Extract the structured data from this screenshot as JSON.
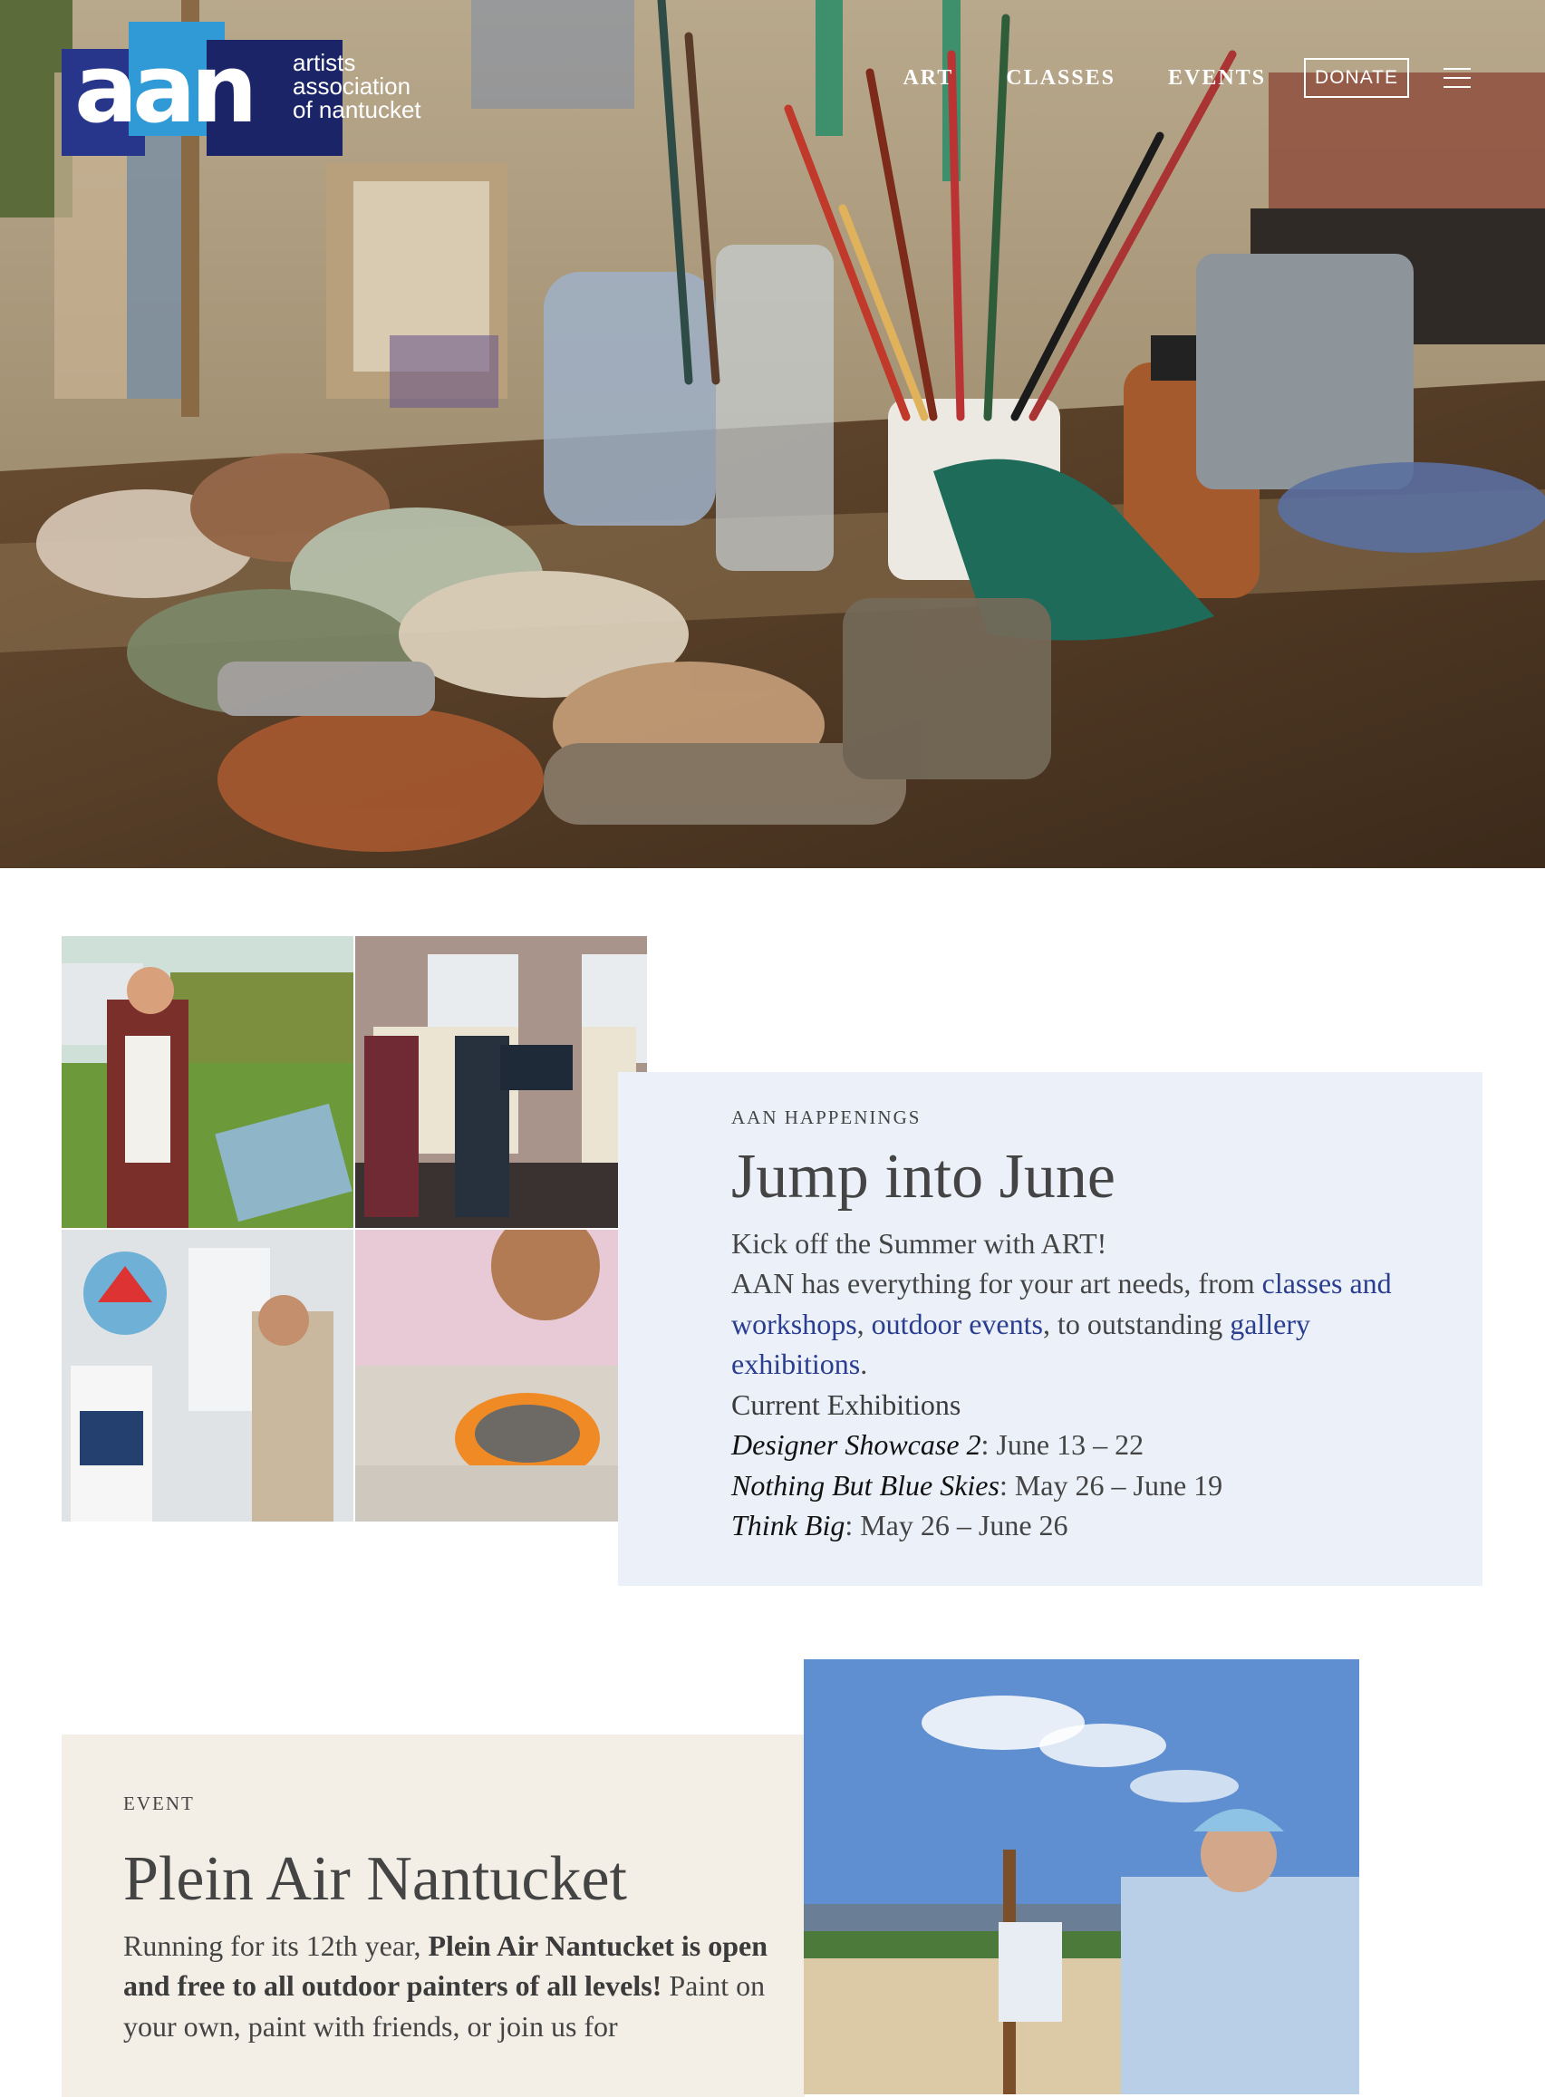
{
  "header": {
    "logo_mark": "aan",
    "logo_lines": [
      "artists",
      "association",
      "of nantucket"
    ],
    "nav": [
      {
        "label": "ART"
      },
      {
        "label": "CLASSES"
      },
      {
        "label": "EVENTS"
      }
    ],
    "donate_label": "DONATE",
    "menu_icon": "hamburger-menu-icon"
  },
  "happenings": {
    "eyebrow": "AAN HAPPENINGS",
    "title": "Jump into June",
    "intro": "Kick off the Summer with ART!",
    "lead_pre": "AAN has everything for your art needs, from ",
    "link_classes": "classes and workshops",
    "sep1": ", ",
    "link_events": "outdoor events",
    "sep2": ", to outstanding ",
    "link_gallery": "gallery exhibitions",
    "lead_end": ".",
    "subheading": "Current Exhibitions",
    "exhibitions": [
      {
        "name": "Designer Showcase 2",
        "dates": ": June 13 – 22"
      },
      {
        "name": "Nothing But Blue Skies",
        "dates": ": May 26 – June 19"
      },
      {
        "name": "Think Big",
        "dates": ": May 26 – June 26"
      }
    ]
  },
  "plein_air": {
    "eyebrow": "EVENT",
    "title": "Plein Air Nantucket",
    "line1_pre": "Running for its 12th year, ",
    "line1_bold": "Plein Air Nantucket is open and free to all outdoor painters of all levels!",
    "line2": " Paint on your own, paint with friends, or join us for"
  },
  "colors": {
    "navy": "#1c2468",
    "brand_blue": "#27358a",
    "sky_blue": "#2f9ad6",
    "link": "#2a3d8f",
    "panel_blue": "#ebf0f9",
    "panel_beige": "#f3efe6"
  }
}
